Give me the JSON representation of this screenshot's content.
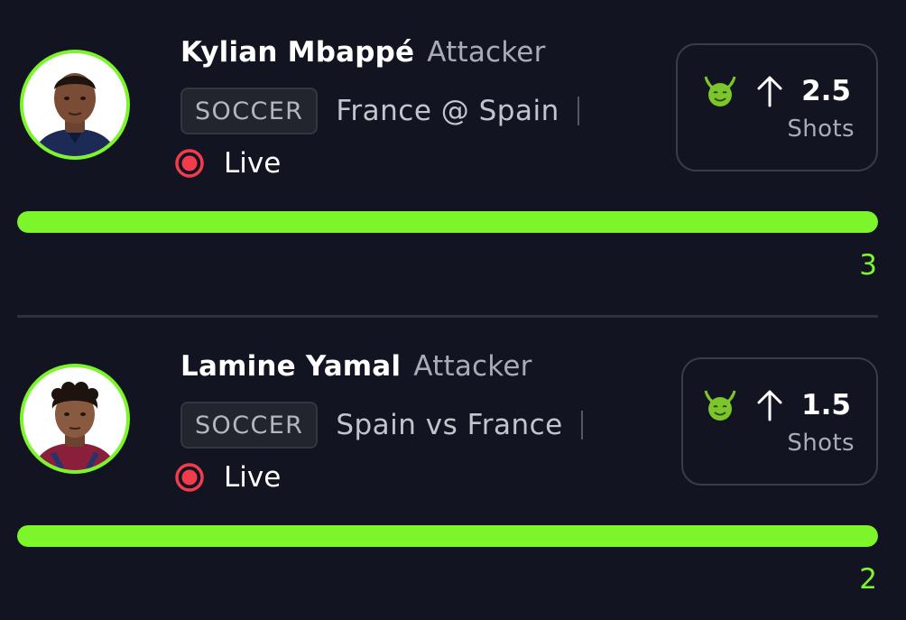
{
  "colors": {
    "background": "#131421",
    "accent_green": "#7cf52a",
    "live_red": "#f23c4c",
    "muted_text": "#a9abb6"
  },
  "players": [
    {
      "name": "Kylian Mbappé",
      "position": "Attacker",
      "sport": "SOCCER",
      "matchup": "France @ Spain",
      "status": "Live",
      "pick": {
        "icon": "devil-icon",
        "direction_icon": "arrow-up-icon",
        "line": "2.5",
        "stat": "Shots"
      },
      "progress_fraction": 1.0,
      "current_value": "3"
    },
    {
      "name": "Lamine Yamal",
      "position": "Attacker",
      "sport": "SOCCER",
      "matchup": "Spain vs France",
      "status": "Live",
      "pick": {
        "icon": "devil-icon",
        "direction_icon": "arrow-up-icon",
        "line": "1.5",
        "stat": "Shots"
      },
      "progress_fraction": 1.0,
      "current_value": "2"
    }
  ]
}
